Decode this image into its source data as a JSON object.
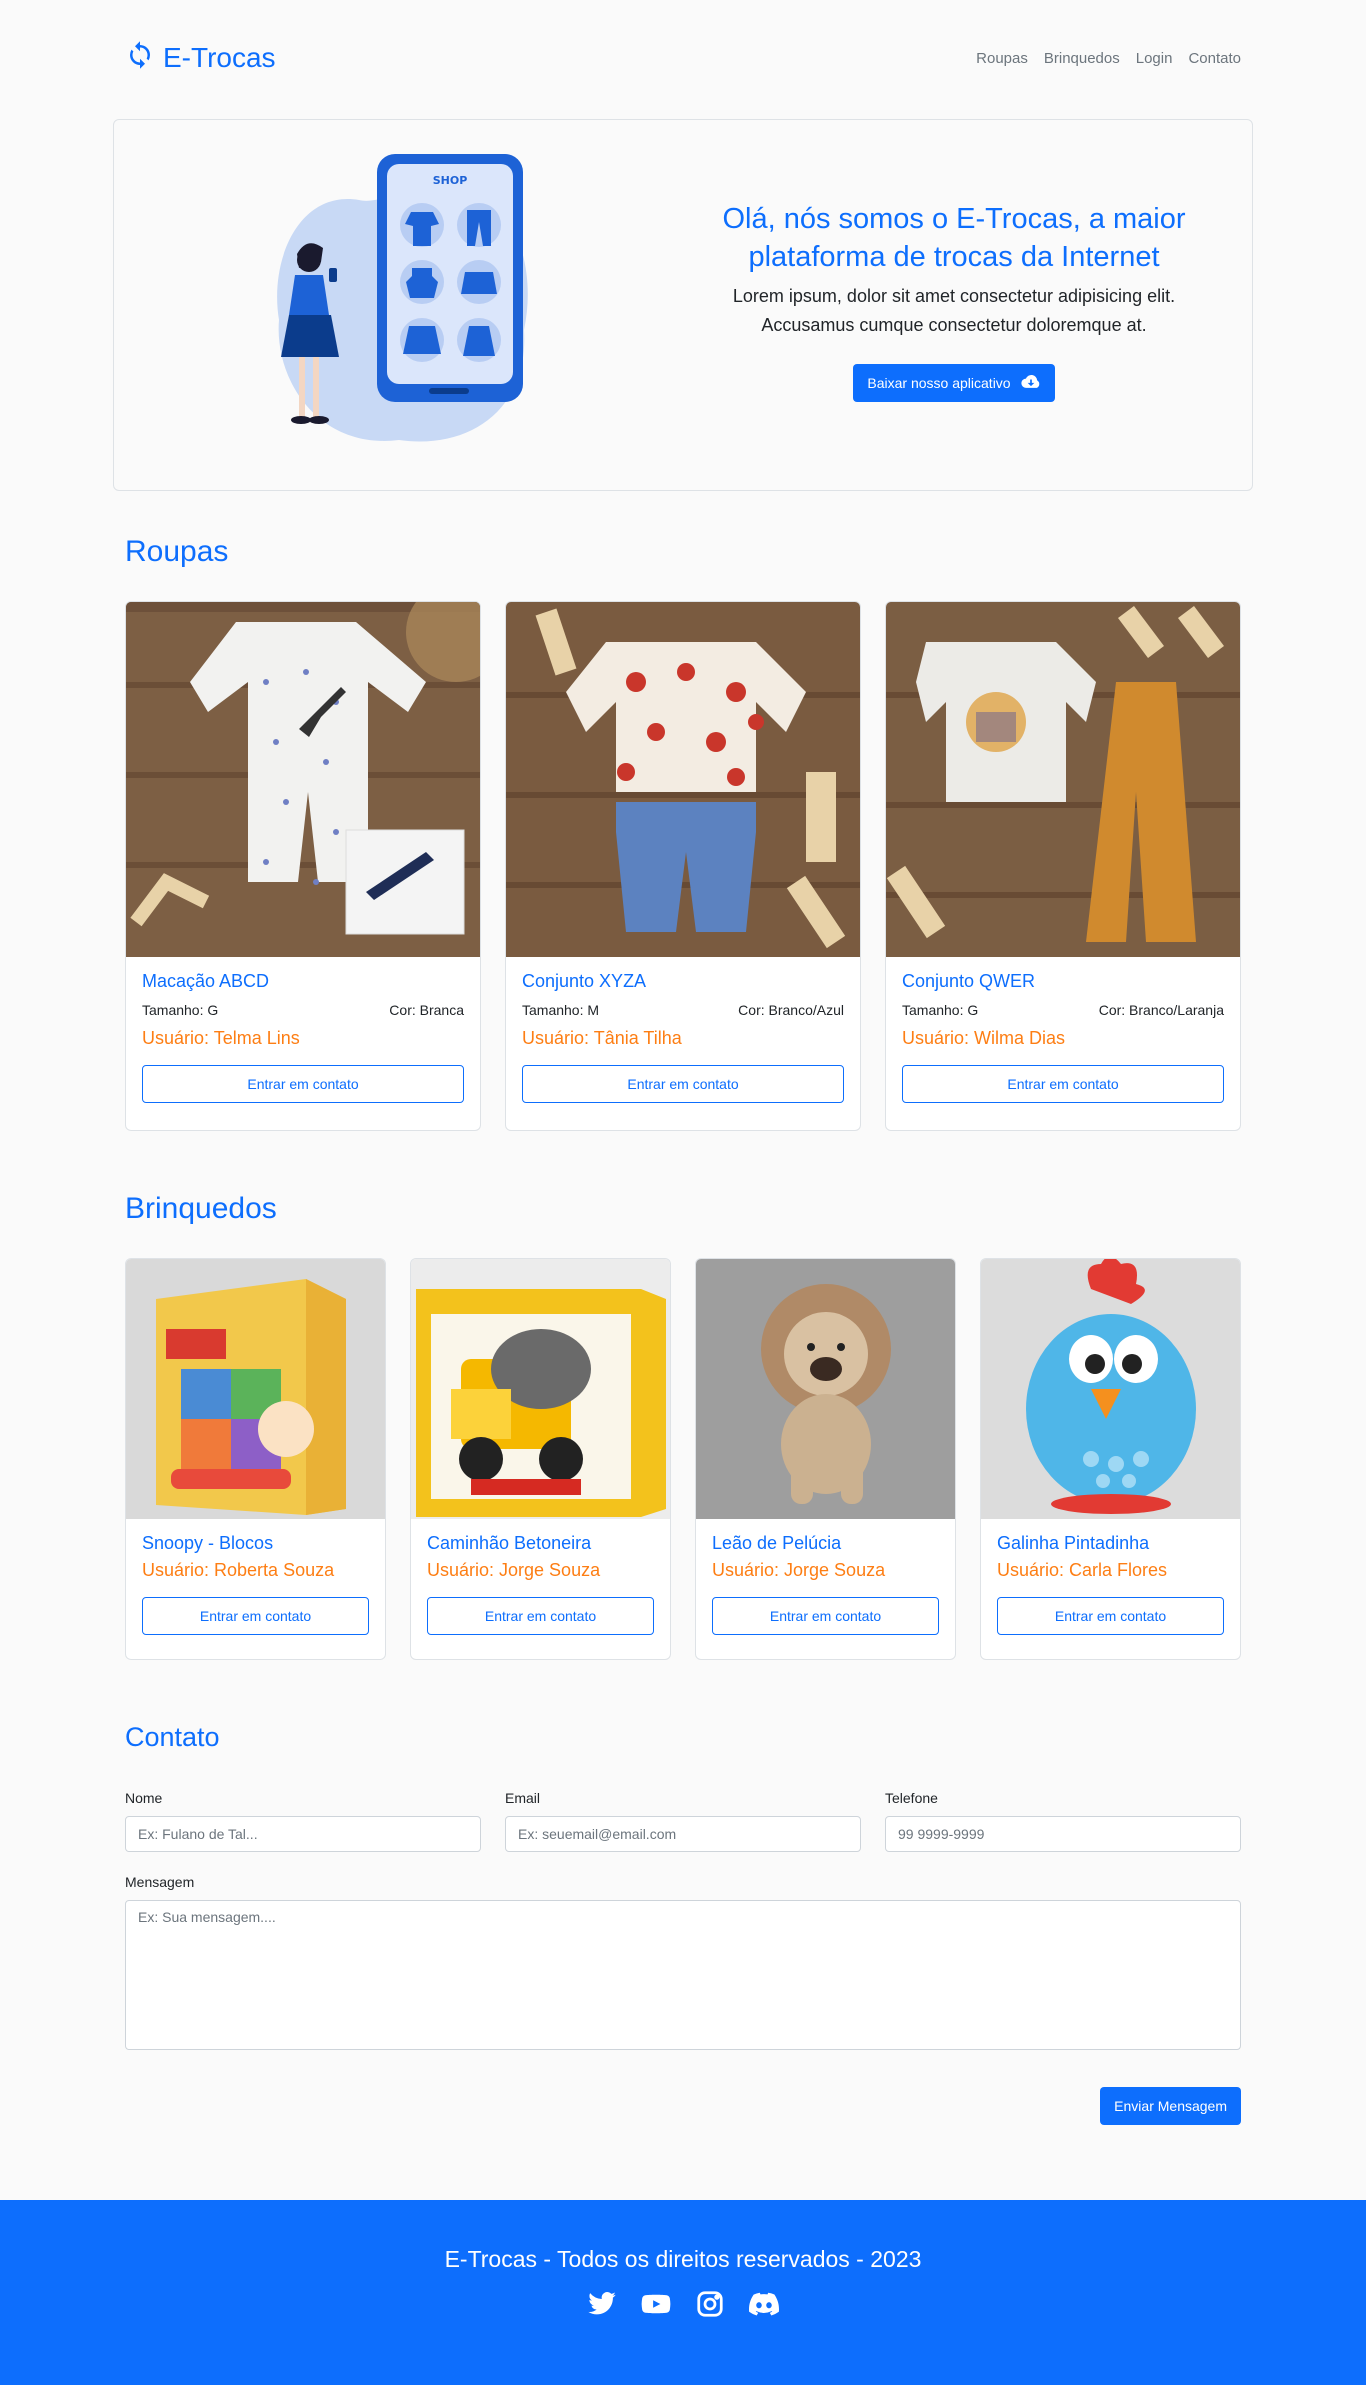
{
  "brand": {
    "name": "E-Trocas",
    "icon": "sync-icon"
  },
  "nav": {
    "items": [
      "Roupas",
      "Brinquedos",
      "Login",
      "Contato"
    ]
  },
  "hero": {
    "title": "Olá, nós somos o E-Trocas, a maior plataforma de trocas da Internet",
    "subtitle": "Lorem ipsum, dolor sit amet consectetur adipisicing elit. Accusamus cumque consectetur doloremque at.",
    "button_label": "Baixar nosso aplicativo",
    "button_icon": "cloud-download-icon",
    "illustration_label": "SHOP"
  },
  "roupas": {
    "title": "Roupas",
    "items": [
      {
        "name": "Macação ABCD",
        "size": "Tamanho: G",
        "color": "Cor: Branca",
        "user": "Usuário: Telma Lins",
        "button": "Entrar em contato"
      },
      {
        "name": "Conjunto XYZA",
        "size": "Tamanho: M",
        "color": "Cor: Branco/Azul",
        "user": "Usuário: Tânia Tilha",
        "button": "Entrar em contato"
      },
      {
        "name": "Conjunto QWER",
        "size": "Tamanho: G",
        "color": "Cor: Branco/Laranja",
        "user": "Usuário: Wilma Dias",
        "button": "Entrar em contato"
      }
    ]
  },
  "brinquedos": {
    "title": "Brinquedos",
    "items": [
      {
        "name": "Snoopy - Blocos",
        "user": "Usuário: Roberta Souza",
        "button": "Entrar em contato"
      },
      {
        "name": "Caminhão Betoneira",
        "user": "Usuário: Jorge Souza",
        "button": "Entrar em contato"
      },
      {
        "name": "Leão de Pelúcia",
        "user": "Usuário: Jorge Souza",
        "button": "Entrar em contato"
      },
      {
        "name": "Galinha Pintadinha",
        "user": "Usuário: Carla Flores",
        "button": "Entrar em contato"
      }
    ]
  },
  "contato": {
    "title": "Contato",
    "fields": {
      "nome": {
        "label": "Nome",
        "placeholder": "Ex: Fulano de Tal..."
      },
      "email": {
        "label": "Email",
        "placeholder": "Ex: seuemail@email.com"
      },
      "telefone": {
        "label": "Telefone",
        "placeholder": "99 9999-9999"
      },
      "mensagem": {
        "label": "Mensagem",
        "placeholder": "Ex: Sua mensagem...."
      }
    },
    "submit_label": "Enviar Mensagem"
  },
  "footer": {
    "text": "E-Trocas - Todos os direitos reservados - 2023",
    "socials": [
      "twitter-icon",
      "youtube-icon",
      "instagram-icon",
      "discord-icon"
    ]
  },
  "colors": {
    "primary": "#0d6efd",
    "accent": "#fd7e14",
    "background": "#fafafa"
  }
}
